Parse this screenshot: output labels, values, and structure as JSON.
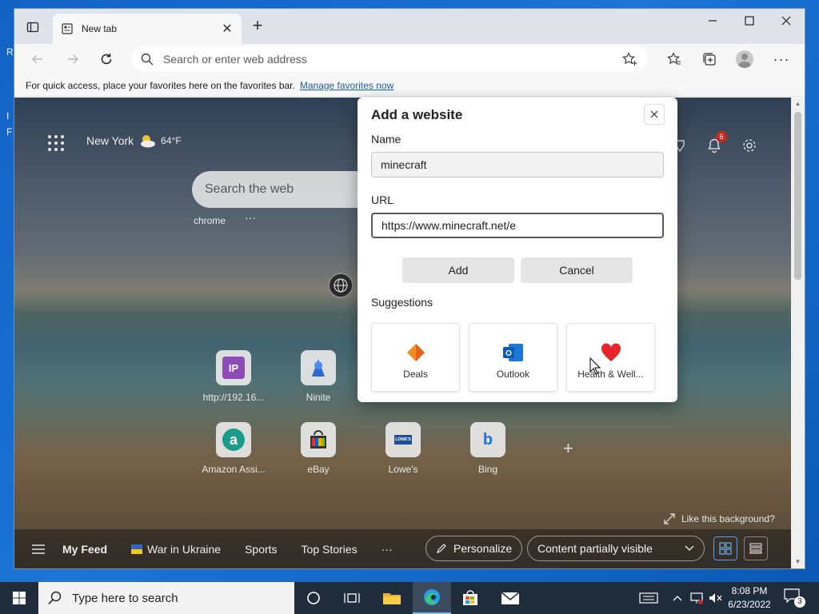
{
  "desktop": {
    "icon_letters": [
      "R",
      "I",
      "F"
    ]
  },
  "browser": {
    "tab": {
      "title": "New tab"
    },
    "address": {
      "placeholder": "Search or enter web address"
    },
    "favbar": {
      "text": "For quick access, place your favorites here on the favorites bar.",
      "link": "Manage favorites now"
    }
  },
  "newtab": {
    "weather": {
      "city": "New York",
      "temp": "64",
      "unit": "°F"
    },
    "search_placeholder": "Search the web",
    "search_label": "chrome",
    "more": "···",
    "notification_count": "6",
    "tiles": [
      {
        "label": "http://192.16...",
        "icon_text": "IP",
        "color": "#8c4bb5"
      },
      {
        "label": "Ninite",
        "icon_text": "",
        "color": "#2f6ad1"
      },
      {
        "label": "Amazon Assi...",
        "icon_text": "a",
        "color": "#1b9b8a"
      },
      {
        "label": "eBay",
        "icon_text": "",
        "color": "#333333"
      },
      {
        "label": "Lowe's",
        "icon_text": "LOWE'S",
        "color": "#1f4f99"
      },
      {
        "label": "Bing",
        "icon_text": "b",
        "color": "#1a73e8"
      }
    ],
    "like_background": "Like this background?",
    "feed": {
      "my_feed": "My Feed",
      "items": [
        "War in Ukraine",
        "Sports",
        "Top Stories"
      ],
      "more": "···",
      "personalize": "Personalize",
      "content_visibility": "Content partially visible"
    }
  },
  "dialog": {
    "title": "Add a website",
    "name_label": "Name",
    "name_value": "minecraft",
    "url_label": "URL",
    "url_value": "https://www.minecraft.net/e",
    "add": "Add",
    "cancel": "Cancel",
    "suggestions_label": "Suggestions",
    "suggestions": [
      {
        "label": "Deals",
        "icon": "deals-icon"
      },
      {
        "label": "Outlook",
        "icon": "outlook-icon"
      },
      {
        "label": "Health & Well...",
        "icon": "heart-icon"
      }
    ]
  },
  "taskbar": {
    "search_placeholder": "Type here to search",
    "time": "8:08 PM",
    "date": "6/23/2022",
    "notifications": "3"
  },
  "colors": {
    "accent": "#1a5fb4",
    "badge": "#c42b1c",
    "taskbar": "#1f2c3c"
  }
}
